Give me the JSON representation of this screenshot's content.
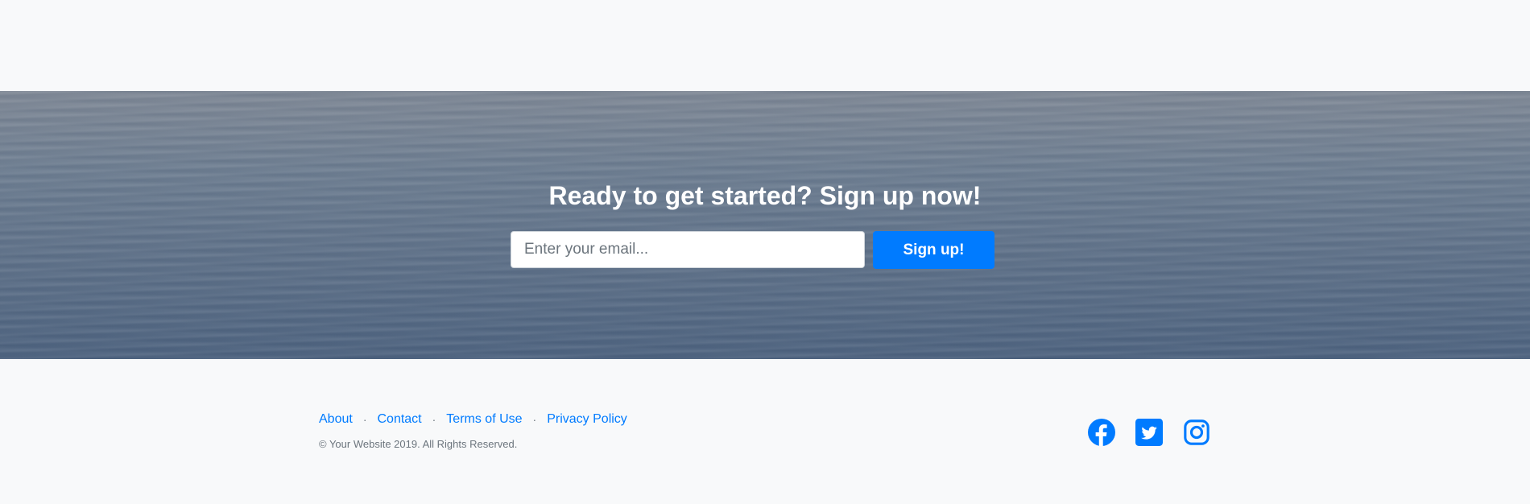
{
  "cta": {
    "title": "Ready to get started? Sign up now!",
    "email_placeholder": "Enter your email...",
    "email_value": "",
    "signup_label": "Sign up!"
  },
  "footer": {
    "links": [
      {
        "label": "About"
      },
      {
        "label": "Contact"
      },
      {
        "label": "Terms of Use"
      },
      {
        "label": "Privacy Policy"
      }
    ],
    "separator": "·",
    "copyright": "© Your Website 2019. All Rights Reserved.",
    "social": [
      {
        "icon": "facebook-icon"
      },
      {
        "icon": "twitter-icon"
      },
      {
        "icon": "instagram-icon"
      }
    ]
  },
  "colors": {
    "accent": "#007bff",
    "page_background": "#f8f9fa",
    "muted_text": "#6c757d"
  }
}
